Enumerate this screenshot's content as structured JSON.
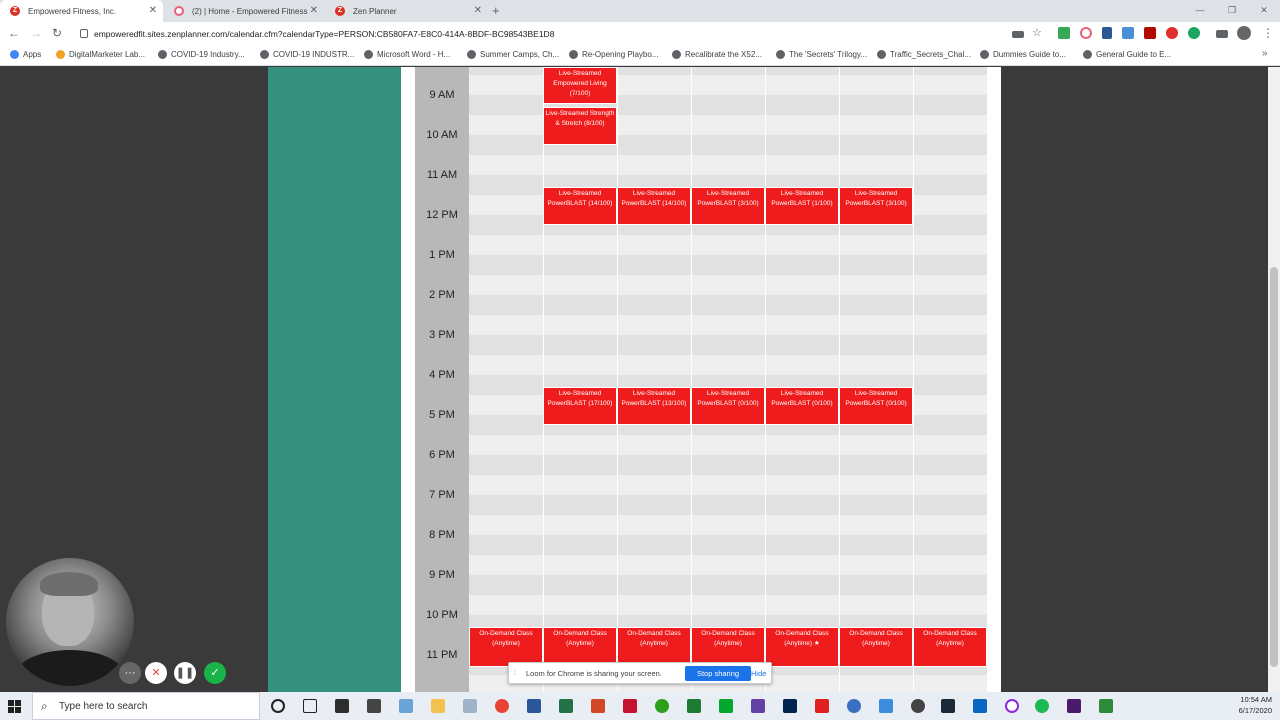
{
  "tabs": [
    {
      "title": "Empowered Fitness, Inc.",
      "active": true
    },
    {
      "title": "(2) | Home - Empowered Fitness",
      "active": false
    },
    {
      "title": "Zen Planner",
      "active": false
    }
  ],
  "address": "empoweredfit.sites.zenplanner.com/calendar.cfm?calendarType=PERSON:CB580FA7-E8C0-414A-8BDF-BC98543BE1D8",
  "bookmarks": [
    {
      "label": "Apps"
    },
    {
      "label": "DigitalMarketer Lab..."
    },
    {
      "label": "COVID-19 Industry..."
    },
    {
      "label": "COVID-19 INDUSTR..."
    },
    {
      "label": "Microsoft Word - H..."
    },
    {
      "label": "Summer Camps, Ch..."
    },
    {
      "label": "Re-Opening Playbo..."
    },
    {
      "label": "Recalibrate the X52..."
    },
    {
      "label": "The 'Secrets' Trilogy..."
    },
    {
      "label": "Traffic_Secrets_Chal..."
    },
    {
      "label": "Dummies Guide to..."
    },
    {
      "label": "General Guide to E..."
    }
  ],
  "calendar": {
    "hours": [
      "9 AM",
      "10 AM",
      "11 AM",
      "12 PM",
      "1 PM",
      "2 PM",
      "3 PM",
      "4 PM",
      "5 PM",
      "6 PM",
      "7 PM",
      "8 PM",
      "9 PM",
      "10 PM",
      "11 PM"
    ],
    "events": [
      {
        "col": 1,
        "text": "Live-Streamed Empowered Living (7/100)"
      },
      {
        "col": 1,
        "text": "Live-Streamed Strength & Stretch (8/100)"
      },
      {
        "col": 1,
        "text": "Live-Streamed PowerBLAST (14/100)"
      },
      {
        "col": 2,
        "text": "Live-Streamed PowerBLAST (14/100)"
      },
      {
        "col": 3,
        "text": "Live-Streamed PowerBLAST (3/100)"
      },
      {
        "col": 4,
        "text": "Live-Streamed PowerBLAST (1/100)"
      },
      {
        "col": 5,
        "text": "Live-Streamed PowerBLAST (3/100)"
      },
      {
        "col": 1,
        "text": "Live-Streamed PowerBLAST (17/100)"
      },
      {
        "col": 2,
        "text": "Live-Streamed PowerBLAST (13/100)"
      },
      {
        "col": 3,
        "text": "Live-Streamed PowerBLAST (0/100)"
      },
      {
        "col": 4,
        "text": "Live-Streamed PowerBLAST (0/100)"
      },
      {
        "col": 5,
        "text": "Live-Streamed PowerBLAST (0/100)"
      },
      {
        "col": 0,
        "text": "On-Demand Class (Anytime)"
      },
      {
        "col": 1,
        "text": "On-Demand Class (Anytime)"
      },
      {
        "col": 2,
        "text": "On-Demand Class (Anytime)"
      },
      {
        "col": 3,
        "text": "On-Demand Class (Anytime)"
      },
      {
        "col": 4,
        "text": "On-Demand Class (Anytime) ★"
      },
      {
        "col": 5,
        "text": "On-Demand Class (Anytime)"
      },
      {
        "col": 6,
        "text": "On-Demand Class (Anytime)"
      }
    ]
  },
  "loom": {
    "sharing_message": "Loom for Chrome is sharing your screen.",
    "stop_label": "Stop sharing",
    "hide_label": "Hide"
  },
  "taskbar": {
    "search_placeholder": "Type here to search",
    "time": "10:54 AM",
    "date": "6/17/2020"
  },
  "colors": {
    "event_red": "#ee1c1c",
    "teal": "#35907e",
    "time_column": "#b8b8b8"
  }
}
